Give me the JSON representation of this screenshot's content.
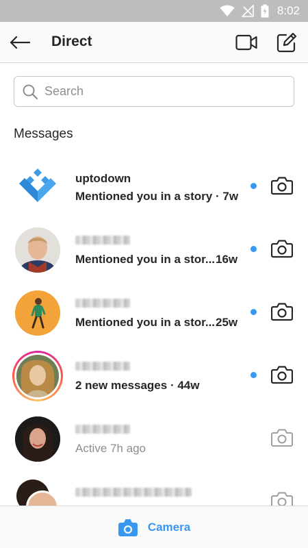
{
  "status_bar": {
    "time": "8:02"
  },
  "header": {
    "title": "Direct"
  },
  "search": {
    "placeholder": "Search"
  },
  "section": {
    "title": "Messages"
  },
  "messages": [
    {
      "name": "uptodown",
      "subtitle": "Mentioned you in a story",
      "time": "· 7w",
      "unread": true
    },
    {
      "name": "",
      "subtitle": "Mentioned you in a stor...",
      "time": "16w",
      "unread": true
    },
    {
      "name": "",
      "subtitle": "Mentioned you in a stor...",
      "time": "25w",
      "unread": true
    },
    {
      "name": "",
      "subtitle": "2 new messages",
      "time": "· 44w",
      "unread": true
    },
    {
      "name": "",
      "subtitle": "Active 7h ago",
      "time": "",
      "unread": false
    },
    {
      "name": "",
      "subtitle": "",
      "time": "",
      "unread": false
    }
  ],
  "bottom_bar": {
    "label": "Camera"
  },
  "colors": {
    "accent": "#3897f0",
    "unread_dot": "#3897f0",
    "status_bar": "#bdbdbd"
  },
  "icons": [
    "wifi-icon",
    "signal-icon",
    "battery-icon",
    "back-arrow-icon",
    "video-camera-icon",
    "compose-icon",
    "search-icon",
    "camera-icon"
  ]
}
